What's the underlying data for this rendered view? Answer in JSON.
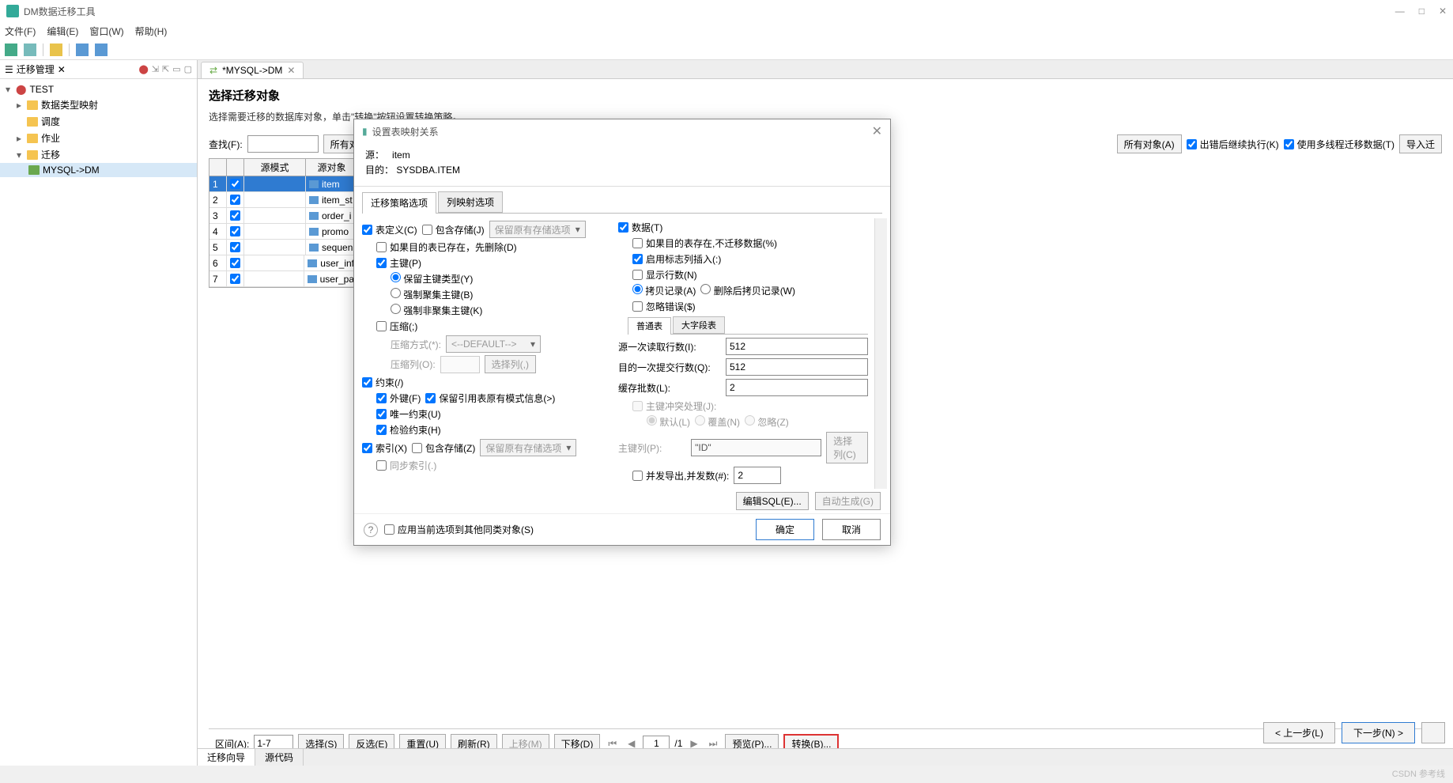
{
  "window": {
    "title": "DM数据迁移工具"
  },
  "menubar": [
    "文件(F)",
    "编辑(E)",
    "窗口(W)",
    "帮助(H)"
  ],
  "sidebar": {
    "title": "迁移管理",
    "root": "TEST",
    "items": [
      "数据类型映射",
      "调度",
      "作业",
      "迁移"
    ],
    "leaf": "MYSQL->DM"
  },
  "main_tab": "*MYSQL->DM",
  "page": {
    "title": "选择迁移对象",
    "subtitle": "选择需要迁移的数据库对象，单击\"转换\"按钮设置转换策略。"
  },
  "find": {
    "label": "查找(F):",
    "btn_all": "所有对",
    "btn_allobj": "所有对象(A)",
    "chk_err_continue": "出错后继续执行(K)",
    "chk_multithread": "使用多线程迁移数据(T)",
    "btn_import": "导入迁"
  },
  "grid": {
    "headers": {
      "mode": "源模式",
      "obj": "源对象"
    },
    "rows": [
      {
        "n": "1",
        "obj": "item",
        "sel": true
      },
      {
        "n": "2",
        "obj": "item_st"
      },
      {
        "n": "3",
        "obj": "order_i"
      },
      {
        "n": "4",
        "obj": "promo"
      },
      {
        "n": "5",
        "obj": "sequen"
      },
      {
        "n": "6",
        "obj": "user_inf"
      },
      {
        "n": "7",
        "obj": "user_pa"
      }
    ]
  },
  "bottom": {
    "range_label": "区间(A):",
    "range": "1-7",
    "btn_select": "选择(S)",
    "btn_invert": "反选(E)",
    "btn_reset": "重置(U)",
    "btn_refresh": "刷新(R)",
    "btn_up": "上移(M)",
    "btn_down": "下移(D)",
    "page": "1",
    "page_total": "/1",
    "btn_preview": "预览(P)...",
    "btn_convert": "转换(B)..."
  },
  "wizard": {
    "prev": "< 上一步(L)",
    "next": "下一步(N) >"
  },
  "src_tabs": [
    "迁移向导",
    "源代码"
  ],
  "dialog": {
    "title": "设置表映射关系",
    "source_label": "源：",
    "source": "item",
    "target_label": "目的：",
    "target": "SYSDBA.ITEM",
    "tabs": [
      "迁移策略选项",
      "列映射选项"
    ],
    "left": {
      "table_def": "表定义(C)",
      "include_storage": "包含存储(J)",
      "storage_opt": "保留原有存储选项",
      "if_exists_drop": "如果目的表已存在，先删除(D)",
      "pk": "主键(P)",
      "pk_keep": "保留主键类型(Y)",
      "pk_cluster": "强制聚集主键(B)",
      "pk_noncluster": "强制非聚集主键(K)",
      "compress": "压缩(;)",
      "compress_mode_label": "压缩方式(*):",
      "compress_mode": "<--DEFAULT-->",
      "compress_col_label": "压缩列(O):",
      "compress_col_btn": "选择列(,)",
      "constraint": "约束(/)",
      "fk": "外键(F)",
      "fk_keep": "保留引用表原有模式信息(>)",
      "unique": "唯一约束(U)",
      "check": "检验约束(H)",
      "index": "索引(X)",
      "index_storage": "包含存储(Z)",
      "index_storage_opt": "保留原有存储选项",
      "sync_index": "同步索引(.)"
    },
    "right": {
      "data": "数据(T)",
      "if_exists_no": "如果目的表存在,不迁移数据(%)",
      "enable_identity": "启用标志列插入(:)",
      "show_rows": "显示行数(N)",
      "copy_records": "拷贝记录(A)",
      "delete_copy": "删除后拷贝记录(W)",
      "ignore_err": "忽略错误($)",
      "inner_tabs": [
        "普通表",
        "大字段表"
      ],
      "src_rows_label": "源一次读取行数(I):",
      "src_rows": "512",
      "dst_rows_label": "目的一次提交行数(Q):",
      "dst_rows": "512",
      "cache_label": "缓存批数(L):",
      "cache": "2",
      "pk_conflict": "主键冲突处理(J):",
      "conflict_default": "默认(L)",
      "conflict_overwrite": "覆盖(N)",
      "conflict_ignore": "忽略(Z)",
      "pk_col_label": "主键列(P):",
      "pk_col": "\"ID\"",
      "pk_col_btn": "选择列(C)",
      "parallel": "并发导出,并发数(#):",
      "parallel_n": "2"
    },
    "sql": {
      "edit": "编辑SQL(E)...",
      "auto": "自动生成(G)"
    },
    "apply_other": "应用当前选项到其他同类对象(S)",
    "ok": "确定",
    "cancel": "取消"
  },
  "watermark": "CSDN 参考线"
}
